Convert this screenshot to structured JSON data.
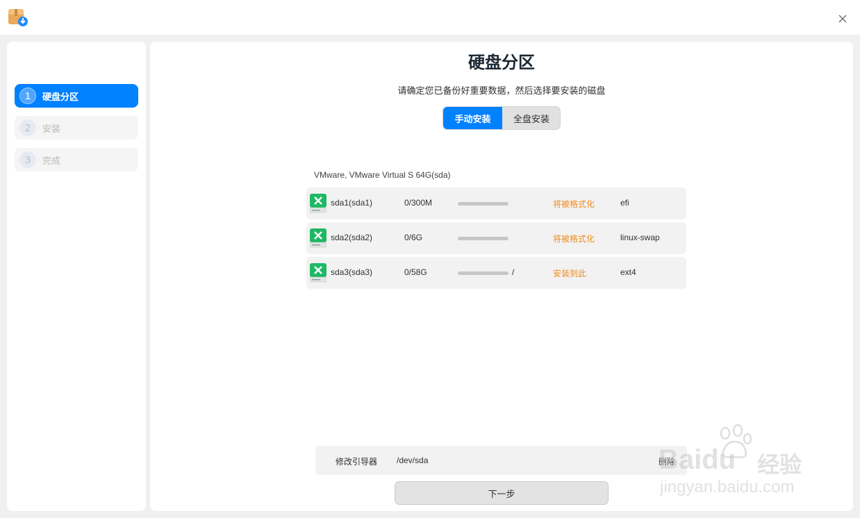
{
  "window": {
    "app_icon": "installer-package-icon",
    "close_icon": "close-icon"
  },
  "sidebar": {
    "steps": [
      {
        "number": "1",
        "label": "硬盘分区",
        "active": true
      },
      {
        "number": "2",
        "label": "安装",
        "active": false
      },
      {
        "number": "3",
        "label": "完成",
        "active": false
      }
    ]
  },
  "main": {
    "title": "硬盘分区",
    "subtitle": "请确定您已备份好重要数据，然后选择要安装的磁盘",
    "modes": {
      "manual": "手动安装",
      "full": "全盘安装",
      "selected": "manual"
    },
    "disk": {
      "title": "VMware, VMware Virtual S 64G(sda)",
      "partitions": [
        {
          "name": "sda1(sda1)",
          "size": "0/300M",
          "usage": 0,
          "mount": "",
          "status": "将被格式化",
          "fs": "efi"
        },
        {
          "name": "sda2(sda2)",
          "size": "0/6G",
          "usage": 0,
          "mount": "",
          "status": "将被格式化",
          "fs": "linux-swap"
        },
        {
          "name": "sda3(sda3)",
          "size": "0/58G",
          "usage": 0,
          "mount": "/",
          "status": "安装到此",
          "fs": "ext4"
        }
      ]
    },
    "bootloader": {
      "label": "修改引导器",
      "value": "/dev/sda",
      "delete": "删除"
    },
    "next_button": "下一步"
  },
  "watermark": {
    "brand": "Baidu",
    "suffix": "经验",
    "url": "jingyan.baidu.com"
  },
  "colors": {
    "accent": "#0081ff",
    "warning": "#f18b1a"
  }
}
